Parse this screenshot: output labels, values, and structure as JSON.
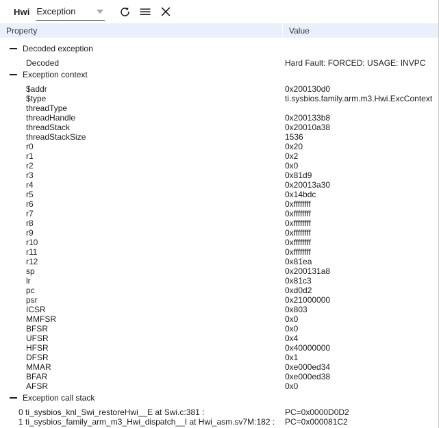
{
  "toolbar": {
    "module_label": "Hwi",
    "view_select": {
      "value": "Exception",
      "arrow_icon": "chevron-down-icon"
    },
    "refresh": {
      "icon": "refresh-icon",
      "title": "Refresh"
    },
    "menu": {
      "icon": "hamburger-menu-icon",
      "title": "Menu"
    },
    "close": {
      "icon": "close-icon",
      "title": "Close"
    }
  },
  "table": {
    "columns": {
      "property": "Property",
      "value": "Value"
    },
    "groups": [
      {
        "label": "Decoded exception",
        "toggle_icon": "minus-icon",
        "rows": [
          {
            "property": "Decoded",
            "value": "Hard Fault: FORCED: USAGE: INVPC"
          }
        ]
      },
      {
        "label": "Exception context",
        "toggle_icon": "minus-icon",
        "rows": [
          {
            "property": "$addr",
            "value": "0x200130d0"
          },
          {
            "property": "$type",
            "value": "ti.sysbios.family.arm.m3.Hwi.ExcContext"
          },
          {
            "property": "threadType",
            "value": ""
          },
          {
            "property": "threadHandle",
            "value": "0x200133b8"
          },
          {
            "property": "threadStack",
            "value": "0x20010a38"
          },
          {
            "property": "threadStackSize",
            "value": "1536"
          },
          {
            "property": "r0",
            "value": "0x20"
          },
          {
            "property": "r1",
            "value": "0x2"
          },
          {
            "property": "r2",
            "value": "0x0"
          },
          {
            "property": "r3",
            "value": "0x81d9"
          },
          {
            "property": "r4",
            "value": "0x20013a30"
          },
          {
            "property": "r5",
            "value": "0x14bdc"
          },
          {
            "property": "r6",
            "value": "0xffffffff"
          },
          {
            "property": "r7",
            "value": "0xffffffff"
          },
          {
            "property": "r8",
            "value": "0xffffffff"
          },
          {
            "property": "r9",
            "value": "0xffffffff"
          },
          {
            "property": "r10",
            "value": "0xffffffff"
          },
          {
            "property": "r11",
            "value": "0xffffffff"
          },
          {
            "property": "r12",
            "value": "0x81ea"
          },
          {
            "property": "sp",
            "value": "0x200131a8"
          },
          {
            "property": "lr",
            "value": "0x81c3"
          },
          {
            "property": "pc",
            "value": "0xd0d2"
          },
          {
            "property": "psr",
            "value": "0x21000000"
          },
          {
            "property": "ICSR",
            "value": "0x803"
          },
          {
            "property": "MMFSR",
            "value": "0x0"
          },
          {
            "property": "BFSR",
            "value": "0x0"
          },
          {
            "property": "UFSR",
            "value": "0x4"
          },
          {
            "property": "HFSR",
            "value": "0x40000000"
          },
          {
            "property": "DFSR",
            "value": "0x1"
          },
          {
            "property": "MMAR",
            "value": "0xe000ed34"
          },
          {
            "property": "BFAR",
            "value": "0xe000ed38"
          },
          {
            "property": "AFSR",
            "value": "0x0"
          }
        ]
      },
      {
        "label": "Exception call stack",
        "toggle_icon": "minus-icon",
        "rows": [
          {
            "property": "0 ti_sysbios_knl_Swi_restoreHwi__E at Swi.c:381 :",
            "value": "PC=0x0000D0D2"
          },
          {
            "property": "1 ti_sysbios_family_arm_m3_Hwi_dispatch__I at Hwi_asm.sv7M:182 :",
            "value": "PC=0x000081C2"
          }
        ]
      }
    ]
  },
  "colors": {
    "header_bg": "#eaf0fb",
    "text": "#1b1b1b",
    "header_text": "#32363c",
    "background": "#ffffff",
    "border": "#c8c8c8"
  }
}
